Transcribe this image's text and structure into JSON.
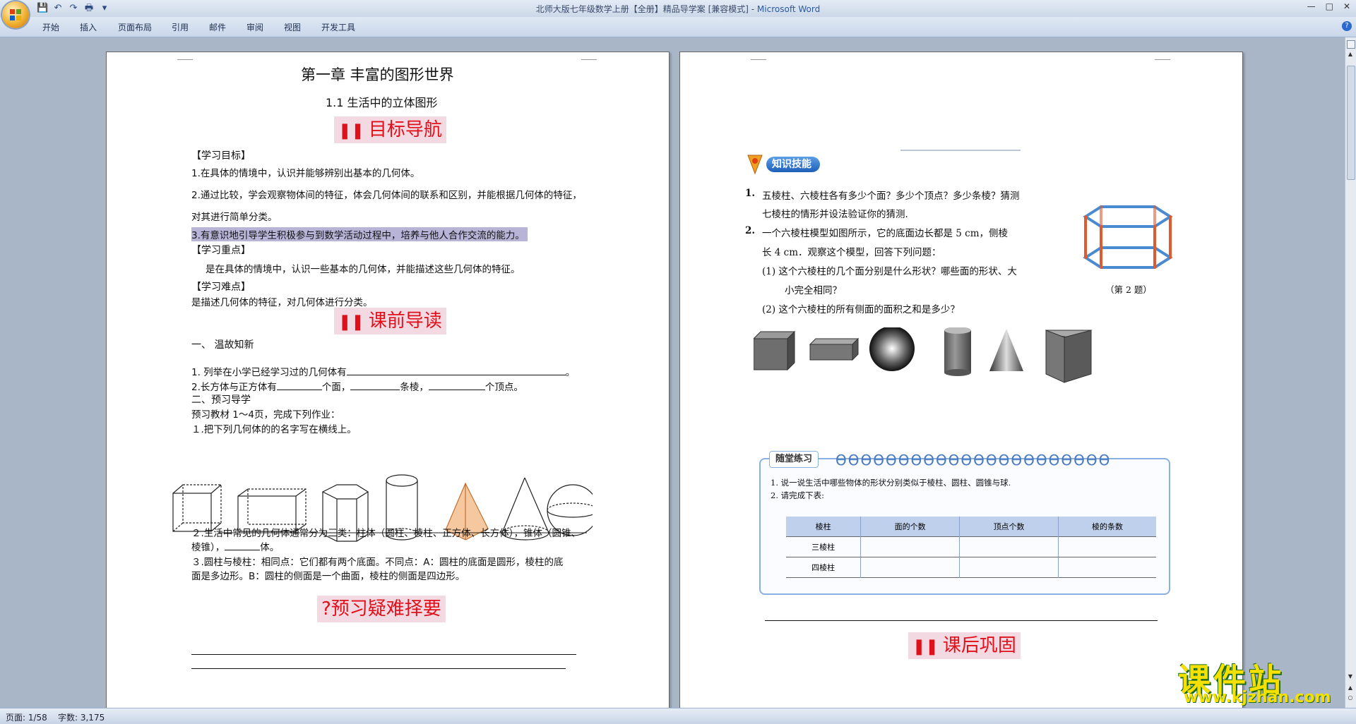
{
  "window": {
    "title_doc": "北师大版七年级数学上册【全册】精品导学案 [兼容模式] - ",
    "title_app": "Microsoft Word"
  },
  "ribbon": {
    "tabs": [
      "开始",
      "插入",
      "页面布局",
      "引用",
      "邮件",
      "审阅",
      "视图",
      "开发工具"
    ]
  },
  "status": {
    "page": "页面: 1/58",
    "words": "字数: 3,175"
  },
  "page1": {
    "chapter_title": "第一章  丰富的图形世界",
    "section_title": "1.1  生活中的立体图形",
    "banner1": "目标导航",
    "goal_heading": "【学习目标】",
    "goal1": "1.在具体的情境中，认识并能够辨别出基本的几何体。",
    "goal2a": "2.通过比较，学会观察物体间的特征，体会几何体间的联系和区别，并能根据几何体的特征，",
    "goal2b": "对其进行简单分类。",
    "goal3": "3.有意识地引导学生积极参与到数学活动过程中，培养与他人合作交流的能力。",
    "key_heading": "【学习重点】",
    "key_text": "是在具体的情境中，认识一些基本的几何体，并能描述这些几何体的特征。",
    "diff_heading": "【学习难点】",
    "diff_text": "是描述几何体的特征，对几何体进行分类。",
    "banner2": "课前导读",
    "review_heading": "一、  温故知新",
    "q1": "1.  列举在小学已经学习过的几何体有",
    "q2_a": "2.长方体与正方体有",
    "q2_b": "个面，",
    "q2_c": "条棱，",
    "q2_d": "个顶点。",
    "preview_heading": "二、预习导学",
    "preview_line": "预习教材 1～4页，完成下列作业：",
    "task1": "１.把下列几何体的的名字写在横线上。",
    "task2a": "２.生活中常见的几何体通常分为三类：柱体（圆柱、棱柱、正方体、长方体），锥体（圆锥、",
    "task2b": "棱锥），",
    "task2c": "体。",
    "task3a": "３.圆柱与棱柱：相同点：它们都有两个底面。不同点：A：圆柱的底面是圆形，棱柱的底",
    "task3b": "面是多边形。B：圆柱的侧面是一个曲面，棱柱的侧面是四边形。",
    "banner3": "?预习疑难择要"
  },
  "page2": {
    "skill_label": "知识技能",
    "p1_num": "1.",
    "p1a": "五棱柱、六棱柱各有多少个面？多少个顶点？多少条棱？猜测",
    "p1b": "七棱柱的情形并设法验证你的猜测.",
    "p2_num": "2.",
    "p2a": "一个六棱柱模型如图所示，它的底面边长都是 5 cm，侧棱",
    "p2b": "长 4 cm．观察这个模型，回答下列问题：",
    "p2c": "(1)  这个六棱柱的几个面分别是什么形状？哪些面的形状、大",
    "p2d": "小完全相同？",
    "p2e": "(2)  这个六棱柱的所有侧面的面积之和是多少？",
    "fig_caption": "（第 2 题）",
    "practice_label": "随堂练习",
    "pr1": "1.   说一说生活中哪些物体的形状分别类似于棱柱、圆柱、圆锥与球.",
    "pr2": "2.   请完成下表:",
    "table_headers": [
      "棱柱",
      "面的个数",
      "顶点个数",
      "棱的条数"
    ],
    "table_rows": [
      [
        "三棱柱",
        "",
        "",
        ""
      ],
      [
        "四棱柱",
        "",
        "",
        ""
      ]
    ],
    "banner4": "课后巩固"
  },
  "watermark": {
    "big": "课件站",
    "small": "www.kjzhan.com"
  }
}
